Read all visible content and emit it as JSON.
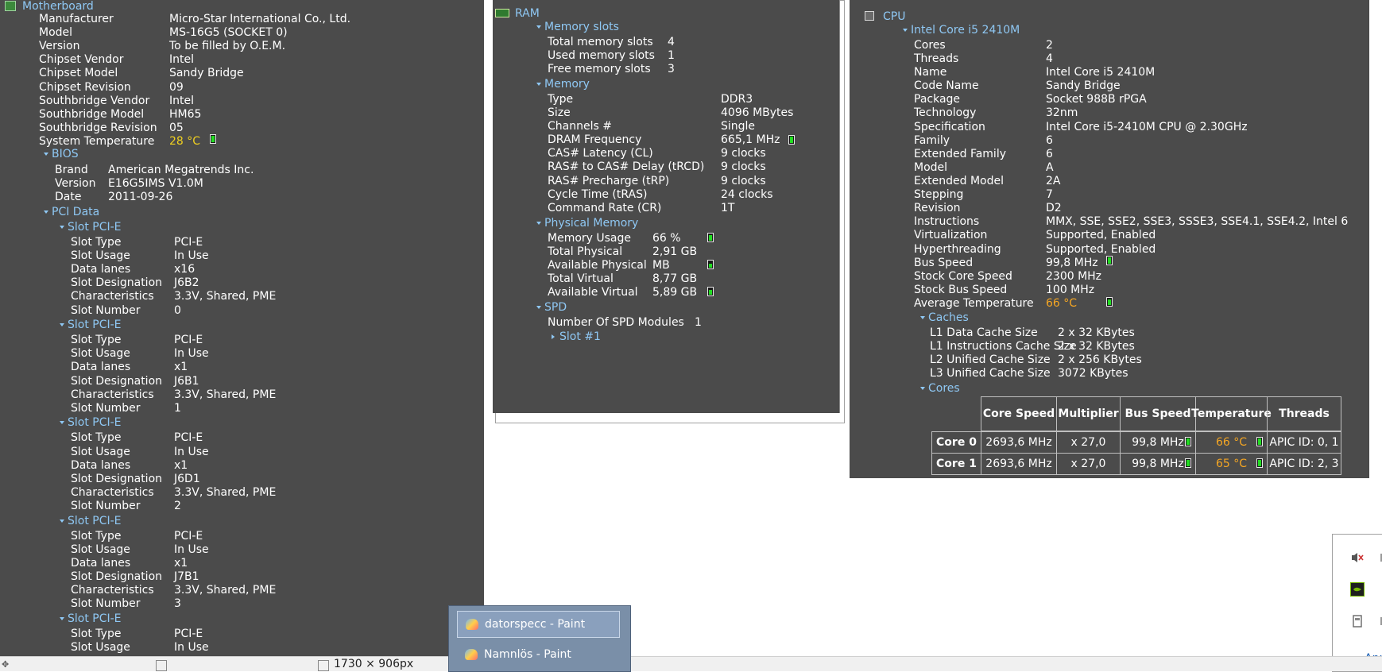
{
  "motherboard": {
    "title": "Motherboard",
    "rows": [
      {
        "label": "Manufacturer",
        "value": "Micro-Star International Co., Ltd."
      },
      {
        "label": "Model",
        "value": "MS-16G5 (SOCKET 0)"
      },
      {
        "label": "Version",
        "value": "To be filled by O.E.M."
      },
      {
        "label": "Chipset Vendor",
        "value": "Intel"
      },
      {
        "label": "Chipset Model",
        "value": "Sandy Bridge"
      },
      {
        "label": "Chipset Revision",
        "value": "09"
      },
      {
        "label": "Southbridge Vendor",
        "value": "Intel"
      },
      {
        "label": "Southbridge Model",
        "value": "HM65"
      },
      {
        "label": "Southbridge Revision",
        "value": "05"
      },
      {
        "label": "System Temperature",
        "value": "28 °C"
      }
    ],
    "bios": {
      "title": "BIOS",
      "rows": [
        {
          "label": "Brand",
          "value": "American Megatrends Inc."
        },
        {
          "label": "Version",
          "value": "E16G5IMS V1.0M"
        },
        {
          "label": "Date",
          "value": "2011-09-26"
        }
      ]
    },
    "pci": {
      "title": "PCI Data",
      "slots": [
        {
          "title": "Slot PCI-E",
          "rows": [
            {
              "label": "Slot Type",
              "value": "PCI-E"
            },
            {
              "label": "Slot Usage",
              "value": "In Use"
            },
            {
              "label": "Data lanes",
              "value": "x16"
            },
            {
              "label": "Slot Designation",
              "value": "J6B2"
            },
            {
              "label": "Characteristics",
              "value": "3.3V, Shared, PME"
            },
            {
              "label": "Slot Number",
              "value": "0"
            }
          ]
        },
        {
          "title": "Slot PCI-E",
          "rows": [
            {
              "label": "Slot Type",
              "value": "PCI-E"
            },
            {
              "label": "Slot Usage",
              "value": "In Use"
            },
            {
              "label": "Data lanes",
              "value": "x1"
            },
            {
              "label": "Slot Designation",
              "value": "J6B1"
            },
            {
              "label": "Characteristics",
              "value": "3.3V, Shared, PME"
            },
            {
              "label": "Slot Number",
              "value": "1"
            }
          ]
        },
        {
          "title": "Slot PCI-E",
          "rows": [
            {
              "label": "Slot Type",
              "value": "PCI-E"
            },
            {
              "label": "Slot Usage",
              "value": "In Use"
            },
            {
              "label": "Data lanes",
              "value": "x1"
            },
            {
              "label": "Slot Designation",
              "value": "J6D1"
            },
            {
              "label": "Characteristics",
              "value": "3.3V, Shared, PME"
            },
            {
              "label": "Slot Number",
              "value": "2"
            }
          ]
        },
        {
          "title": "Slot PCI-E",
          "rows": [
            {
              "label": "Slot Type",
              "value": "PCI-E"
            },
            {
              "label": "Slot Usage",
              "value": "In Use"
            },
            {
              "label": "Data lanes",
              "value": "x1"
            },
            {
              "label": "Slot Designation",
              "value": "J7B1"
            },
            {
              "label": "Characteristics",
              "value": "3.3V, Shared, PME"
            },
            {
              "label": "Slot Number",
              "value": "3"
            }
          ]
        },
        {
          "title": "Slot PCI-E",
          "rows": [
            {
              "label": "Slot Type",
              "value": "PCI-E"
            },
            {
              "label": "Slot Usage",
              "value": "In Use"
            }
          ]
        }
      ]
    }
  },
  "ram": {
    "title": "RAM",
    "slots_group": {
      "title": "Memory slots",
      "rows": [
        {
          "label": "Total memory slots",
          "value": "4"
        },
        {
          "label": "Used memory slots",
          "value": "1"
        },
        {
          "label": "Free memory slots",
          "value": "3"
        }
      ]
    },
    "memory_group": {
      "title": "Memory",
      "rows": [
        {
          "label": "Type",
          "value": "DDR3"
        },
        {
          "label": "Size",
          "value": "4096 MBytes"
        },
        {
          "label": "Channels #",
          "value": "Single"
        },
        {
          "label": "DRAM Frequency",
          "value": "665,1 MHz"
        },
        {
          "label": "CAS# Latency (CL)",
          "value": "9 clocks"
        },
        {
          "label": "RAS# to CAS# Delay (tRCD)",
          "value": "9 clocks"
        },
        {
          "label": "RAS# Precharge (tRP)",
          "value": "9 clocks"
        },
        {
          "label": "Cycle Time (tRAS)",
          "value": "24 clocks"
        },
        {
          "label": "Command Rate (CR)",
          "value": "1T"
        }
      ]
    },
    "physical_group": {
      "title": "Physical Memory",
      "rows": [
        {
          "label": "Memory Usage",
          "value": "66 %"
        },
        {
          "label": "Total Physical",
          "value": "2,91 GB"
        },
        {
          "label": "Available Physical",
          "value": "MB"
        },
        {
          "label": "Total Virtual",
          "value": "8,77 GB"
        },
        {
          "label": "Available Virtual",
          "value": "5,89 GB"
        }
      ]
    },
    "spd_group": {
      "title": "SPD",
      "rows": [
        {
          "label": "Number Of SPD Modules",
          "value": "1"
        }
      ],
      "slot_link": "Slot #1"
    }
  },
  "cpu": {
    "title": "CPU",
    "model_title": "Intel Core i5 2410M",
    "rows": [
      {
        "label": "Cores",
        "value": "2"
      },
      {
        "label": "Threads",
        "value": "4"
      },
      {
        "label": "Name",
        "value": "Intel Core i5 2410M"
      },
      {
        "label": "Code Name",
        "value": "Sandy Bridge"
      },
      {
        "label": "Package",
        "value": "Socket 988B rPGA"
      },
      {
        "label": "Technology",
        "value": "32nm"
      },
      {
        "label": "Specification",
        "value": "Intel Core i5-2410M CPU @ 2.30GHz"
      },
      {
        "label": "Family",
        "value": "6"
      },
      {
        "label": "Extended Family",
        "value": "6"
      },
      {
        "label": "Model",
        "value": "A"
      },
      {
        "label": "Extended Model",
        "value": "2A"
      },
      {
        "label": "Stepping",
        "value": "7"
      },
      {
        "label": "Revision",
        "value": "D2"
      },
      {
        "label": "Instructions",
        "value": "MMX, SSE, SSE2, SSE3, SSSE3, SSE4.1, SSE4.2, Intel 6"
      },
      {
        "label": "Virtualization",
        "value": "Supported, Enabled"
      },
      {
        "label": "Hyperthreading",
        "value": "Supported, Enabled"
      },
      {
        "label": "Bus Speed",
        "value": "99,8 MHz"
      },
      {
        "label": "Stock Core Speed",
        "value": "2300 MHz"
      },
      {
        "label": "Stock Bus Speed",
        "value": "100 MHz"
      },
      {
        "label": "Average Temperature",
        "value": "66 °C"
      }
    ],
    "caches": {
      "title": "Caches",
      "rows": [
        {
          "label": "L1 Data Cache Size",
          "value": "2 x 32 KBytes"
        },
        {
          "label": "L1 Instructions Cache Size",
          "value": "2 x 32 KBytes"
        },
        {
          "label": "L2 Unified Cache Size",
          "value": "2 x 256 KBytes"
        },
        {
          "label": "L3 Unified Cache Size",
          "value": "3072 KBytes"
        }
      ]
    },
    "cores": {
      "title": "Cores",
      "headers": [
        "Core Speed",
        "Multiplier",
        "Bus Speed",
        "Temperature",
        "Threads"
      ],
      "rows": [
        {
          "name": "Core 0",
          "speed": "2693,6 MHz",
          "mult": "x 27,0",
          "bus": "99,8 MHz",
          "temp": "66 °C",
          "threads": "APIC ID: 0, 1"
        },
        {
          "name": "Core 1",
          "speed": "2693,6 MHz",
          "mult": "x 27,0",
          "bus": "99,8 MHz",
          "temp": "65 °C",
          "threads": "APIC ID: 2, 3"
        }
      ]
    }
  },
  "taskbar": {
    "status_size": "1730 × 906px",
    "popup_items": [
      "datorspecc - Paint",
      "Namnlös - Paint"
    ],
    "corner_text": "Anp"
  },
  "colors": {
    "panel": "#4b4b4b",
    "header": "#8fc8f4",
    "warm": "#f5a623",
    "bar": "#22dd22"
  }
}
